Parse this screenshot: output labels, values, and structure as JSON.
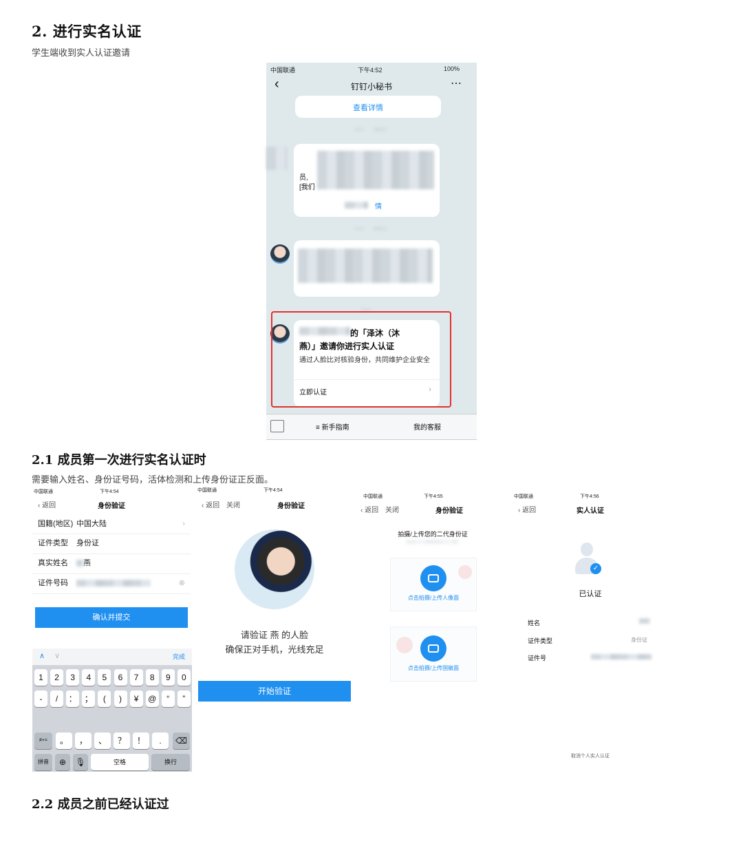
{
  "section2": {
    "title": "2. 进行实名认证",
    "subtitle": "学生端收到实人认证邀请"
  },
  "phone1": {
    "status_carrier": "中国联通",
    "status_time": "下午4:52",
    "status_battery": "100%",
    "nav_title": "钉钉小秘书",
    "view_details": "查看详情",
    "partial_text_1": "员,",
    "partial_text_2": "[我们",
    "partial_link": "情",
    "invite_title_1": "的「泽沐（沐",
    "invite_title_2": "燕）」邀请你进行实人认证",
    "invite_desc": "通过人脸比对核验身份，共同维护企业安全",
    "invite_action": "立即认证",
    "tab_guide": "新手指南",
    "tab_service": "我的客服"
  },
  "section21": {
    "title": "2.1 成员第一次进行实名认证时",
    "note": "需要输入姓名、身份证号码，活体检测和上传身份证正反面。"
  },
  "screen_a": {
    "status_time": "下午4:54",
    "back": "返回",
    "title": "身份验证",
    "rows": [
      {
        "label": "国籍(地区)",
        "value": "中国大陆"
      },
      {
        "label": "证件类型",
        "value": "身份证"
      },
      {
        "label": "真实姓名",
        "value": "燕"
      },
      {
        "label": "证件号码",
        "value": ""
      }
    ],
    "submit": "确认并提交",
    "done": "完成",
    "keys_row1": [
      "1",
      "2",
      "3",
      "4",
      "5",
      "6",
      "7",
      "8",
      "9",
      "0"
    ],
    "keys_row2": [
      "-",
      "/",
      "：",
      "；",
      "(",
      ")",
      "¥",
      "@",
      "“",
      "”"
    ],
    "keys_row3": [
      "。",
      "，",
      "、",
      "？",
      "！",
      "."
    ],
    "key_switch": "#+=",
    "key_pinyin": "拼音",
    "key_space": "空格",
    "key_enter": "换行"
  },
  "screen_b": {
    "status_time": "下午4:54",
    "back": "返回",
    "close": "关闭",
    "title": "身份验证",
    "line1": "请验证 燕 的人脸",
    "line2": "确保正对手机，光线充足",
    "start": "开始验证"
  },
  "screen_c": {
    "status_time": "下午4:55",
    "back": "返回",
    "close": "关闭",
    "title": "身份验证",
    "instruction": "拍摄/上传您的二代身份证",
    "upload_front": "点击拍摄/上传人像面",
    "upload_back": "点击拍摄/上传国徽面"
  },
  "screen_d": {
    "status_time": "下午4:56",
    "back": "返回",
    "title": "实人认证",
    "verified": "已认证",
    "name_label": "姓名",
    "type_label": "证件类型",
    "type_value": "身份证",
    "number_label": "证件号",
    "cancel": "取消个人实人认证"
  },
  "section22": {
    "title": "2.2 成员之前已经认证过"
  },
  "colors": {
    "accent": "#1f8ff0",
    "highlight": "#e2302c"
  }
}
